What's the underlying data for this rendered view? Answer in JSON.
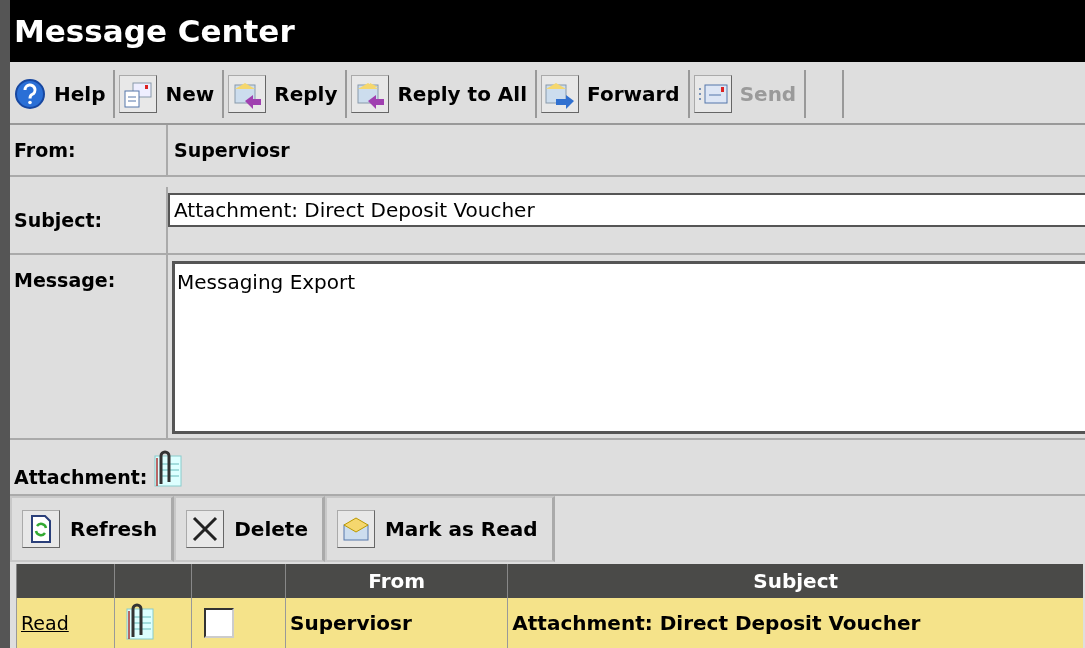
{
  "window": {
    "title": "Message Center"
  },
  "toolbar": [
    {
      "kind": "help",
      "label": "Help",
      "disabled": false
    },
    {
      "kind": "new",
      "label": "New",
      "disabled": false
    },
    {
      "kind": "reply",
      "label": "Reply",
      "disabled": false
    },
    {
      "kind": "reply_all",
      "label": "Reply to All",
      "disabled": false
    },
    {
      "kind": "forward",
      "label": "Forward",
      "disabled": false
    },
    {
      "kind": "send",
      "label": "Send",
      "disabled": true
    }
  ],
  "form": {
    "from_label": "From:",
    "from": "Superviosr",
    "subject_label": "Subject:",
    "subject": "Attachment: Direct Deposit Voucher",
    "message_label": "Message:",
    "message": "Messaging Export",
    "attachment_label": "Attachment:"
  },
  "actions": [
    {
      "kind": "refresh",
      "label": "Refresh"
    },
    {
      "kind": "delete",
      "label": "Delete"
    },
    {
      "kind": "mark_read",
      "label": "Mark as Read"
    }
  ],
  "table": {
    "columns": [
      "",
      "",
      "",
      "From",
      "Subject"
    ],
    "rows": [
      {
        "link": "Read",
        "attachment": true,
        "checked": false,
        "from": "Superviosr",
        "subject": "Attachment: Direct Deposit Voucher"
      }
    ]
  }
}
